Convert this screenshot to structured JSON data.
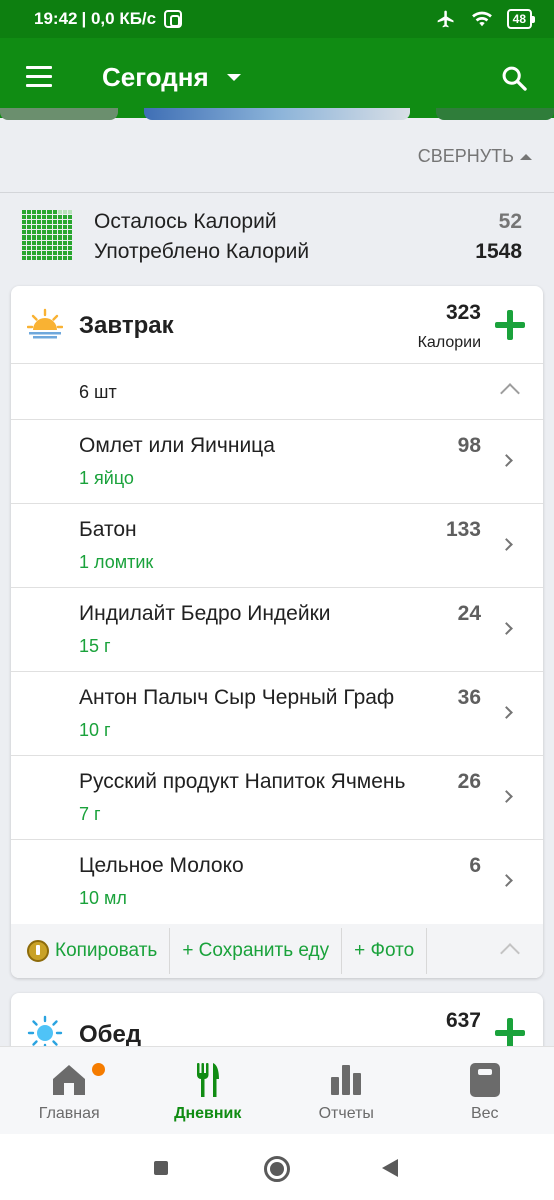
{
  "status_bar": {
    "time": "19:42",
    "speed": "| 0,0 КБ/с",
    "battery": "48"
  },
  "app_bar": {
    "title": "Сегодня"
  },
  "collapse_label": "СВЕРНУТЬ",
  "summary": {
    "remaining_label": "Осталось Калорий",
    "remaining_value": "52",
    "consumed_label": "Употреблено Калорий",
    "consumed_value": "1548"
  },
  "breakfast": {
    "title": "Завтрак",
    "calories": "323",
    "calories_unit": "Калории",
    "count": "6 шт",
    "items": [
      {
        "name": "Омлет или Яичница",
        "portion": "1 яйцо",
        "calories": "98"
      },
      {
        "name": "Батон",
        "portion": "1 ломтик",
        "calories": "133"
      },
      {
        "name": "Индилайт Бедро Индейки",
        "portion": "15 г",
        "calories": "24"
      },
      {
        "name": "Антон Палыч Сыр Черный Граф",
        "portion": "10 г",
        "calories": "36"
      },
      {
        "name": "Русский продукт Напиток Ячмень",
        "portion": "7 г",
        "calories": "26"
      },
      {
        "name": "Цельное Молоко",
        "portion": "10 мл",
        "calories": "6"
      }
    ],
    "actions": {
      "copy": "Копировать",
      "save": "+ Сохранить еду",
      "photo": "+ Фото"
    }
  },
  "lunch": {
    "title": "Обед",
    "calories": "637"
  },
  "bottom_nav": {
    "home": "Главная",
    "diary": "Дневник",
    "reports": "Отчеты",
    "weight": "Вес"
  },
  "colors": {
    "brand_green": "#108c13",
    "accent_green": "#1aa23b",
    "notification": "#f57c00"
  }
}
